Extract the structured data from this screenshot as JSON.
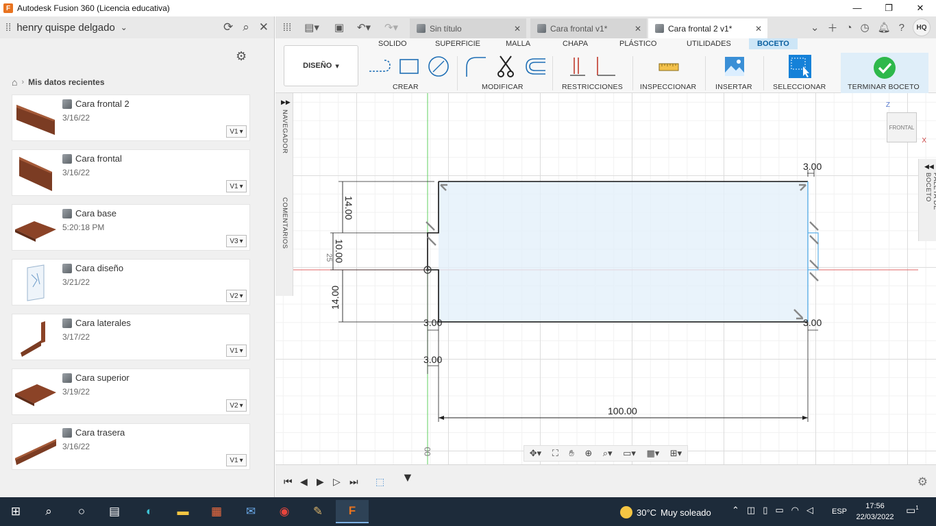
{
  "window": {
    "title": "Autodesk Fusion 360 (Licencia educativa)",
    "logo_letter": "F",
    "minimize": "—",
    "maximize": "❐",
    "close": "✕"
  },
  "data_panel": {
    "user": "henry quispe delgado",
    "breadcrumb": "Mis datos recientes",
    "files": [
      {
        "name": "Cara frontal 2",
        "date": "3/16/22",
        "version": "V1"
      },
      {
        "name": "Cara frontal",
        "date": "3/16/22",
        "version": "V1"
      },
      {
        "name": "Cara base",
        "date": "5:20:18 PM",
        "version": "V3"
      },
      {
        "name": "Cara diseño",
        "date": "3/21/22",
        "version": "V2"
      },
      {
        "name": "Cara laterales",
        "date": "3/17/22",
        "version": "V1"
      },
      {
        "name": "Cara superior",
        "date": "3/19/22",
        "version": "V2"
      },
      {
        "name": "Cara trasera",
        "date": "3/16/22",
        "version": "V1"
      }
    ]
  },
  "doc_tabs": [
    {
      "label": "Sin título"
    },
    {
      "label": "Cara frontal v1*"
    },
    {
      "label": "Cara frontal 2 v1*"
    }
  ],
  "user_initials": "HQ",
  "toolbar": {
    "workspace": "DISEÑO",
    "tabs": [
      "SOLIDO",
      "SUPERFICIE",
      "MALLA",
      "CHAPA",
      "PLÁSTICO",
      "UTILIDADES",
      "BOCETO"
    ],
    "groups": [
      "CREAR",
      "MODIFICAR",
      "RESTRICCIONES",
      "INSPECCIONAR",
      "INSERTAR",
      "SELECCIONAR",
      "TERMINAR BOCETO"
    ]
  },
  "canvas": {
    "navigator_label": "NAVEGADOR",
    "comments_label": "COMENTARIOS",
    "palette_label": "PALETA DE BOCETO",
    "viewcube_face": "FRONTAL",
    "axis_z": "Z",
    "axis_x": "X",
    "dimensions": {
      "top_right": "3.00",
      "left_top": "14.00",
      "left_mid": "10.00",
      "left_bottom": "14.00",
      "left_mid_small": "25",
      "bottom_left_a": "3.00",
      "bottom_left_b": "3.00",
      "bottom_right": "3.00",
      "bottom_width": "100.00",
      "bottom_edge": "00"
    }
  },
  "taskbar": {
    "weather_temp": "30°C",
    "weather_desc": "Muy soleado",
    "language": "ESP",
    "time": "17:56",
    "date": "22/03/2022",
    "notifications": "1"
  }
}
